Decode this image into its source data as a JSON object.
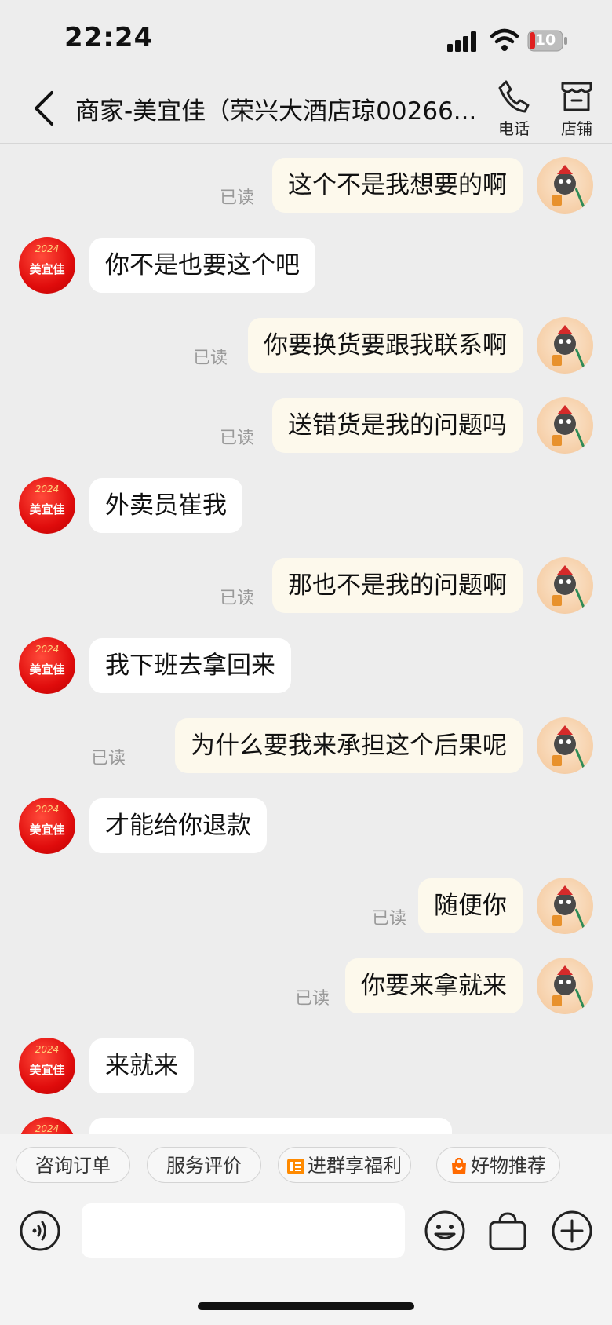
{
  "status_bar": {
    "time": "22:24",
    "battery": "10"
  },
  "header": {
    "title": "商家-美宜佳（荣兴大酒店琼00266...",
    "phone_label": "电话",
    "shop_label": "店铺"
  },
  "merchant_avatar": {
    "brand": "美宜佳",
    "year": "2024"
  },
  "messages": [
    {
      "side": "right",
      "text": "这个不是我想要的啊",
      "read": "已读"
    },
    {
      "side": "left",
      "text": "你不是也要这个吧"
    },
    {
      "side": "right",
      "text": "你要换货要跟我联系啊",
      "read": "已读"
    },
    {
      "side": "right",
      "text": "送错货是我的问题吗",
      "read": "已读"
    },
    {
      "side": "left",
      "text": "外卖员崔我"
    },
    {
      "side": "right",
      "text": "那也不是我的问题啊",
      "read": "已读"
    },
    {
      "side": "left",
      "text": "我下班去拿回来"
    },
    {
      "side": "right",
      "text": "为什么要我来承担这个后果呢",
      "read": "已读"
    },
    {
      "side": "left",
      "text": "才能给你退款"
    },
    {
      "side": "right",
      "text": "随便你",
      "read": "已读"
    },
    {
      "side": "right",
      "text": "你要来拿就来",
      "read": "已读"
    },
    {
      "side": "left",
      "text": "来就来"
    }
  ],
  "quick_actions": {
    "consult_order": "咨询订单",
    "service_review": "服务评价",
    "join_group": "进群享福利",
    "recommend": "好物推荐"
  },
  "input": {
    "placeholder": ""
  },
  "colors": {
    "background": "#ededed",
    "bubble_self": "#fdf9ec",
    "bubble_other": "#ffffff",
    "brand_red": "#e00c0c",
    "accent_orange": "#ff8a00"
  }
}
